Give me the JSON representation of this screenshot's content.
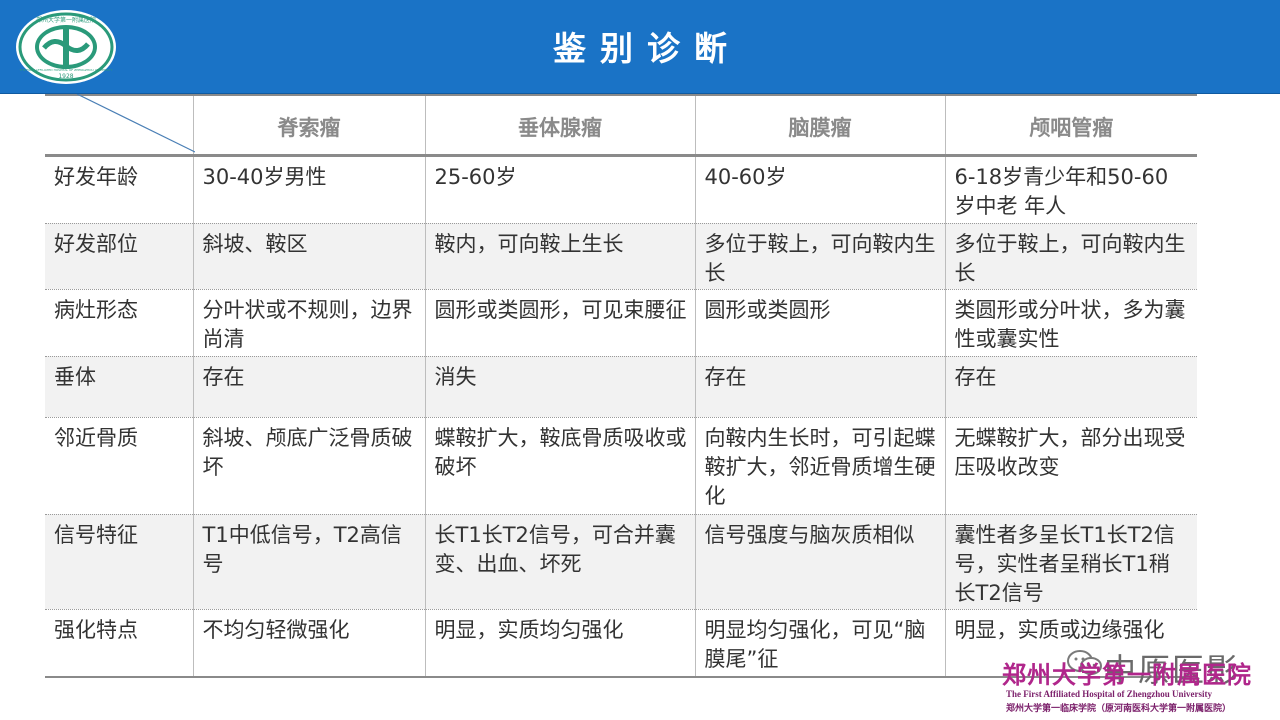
{
  "header": {
    "title": "鉴别诊断",
    "logo": {
      "ring_text": "郑州大学第一附属医院",
      "en_ring_text": "THE FIRST AFFILIATED HOSPITAL OF ZHENGZHOU UNIVERSITY",
      "year": "1928"
    }
  },
  "table": {
    "headers": [
      "",
      "脊索瘤",
      "垂体腺瘤",
      "脑膜瘤",
      "颅咽管瘤"
    ],
    "rows": [
      {
        "label": "好发年龄",
        "cells": [
          "30-40岁男性",
          "25-60岁",
          "40-60岁",
          "6-18岁青少年和50-60岁中老 年人"
        ]
      },
      {
        "label": "好发部位",
        "cells": [
          "斜坡、鞍区",
          "鞍内，可向鞍上生长",
          "多位于鞍上，可向鞍内生长",
          "多位于鞍上，可向鞍内生长"
        ]
      },
      {
        "label": "病灶形态",
        "cells": [
          "分叶状或不规则，边界尚清",
          "圆形或类圆形，可见束腰征",
          "圆形或类圆形",
          "类圆形或分叶状，多为囊性或囊实性"
        ]
      },
      {
        "label": "垂体",
        "cells": [
          "存在",
          "消失",
          "存在",
          "存在"
        ]
      },
      {
        "label": "邻近骨质",
        "cells": [
          "斜坡、颅底广泛骨质破坏",
          "蝶鞍扩大，鞍底骨质吸收或破坏",
          "向鞍内生长时，可引起蝶鞍扩大，邻近骨质增生硬化",
          "无蝶鞍扩大，部分出现受压吸收改变"
        ]
      },
      {
        "label": "信号特征",
        "cells": [
          "T1中低信号，T2高信号",
          "长T1长T2信号，可合并囊变、出血、坏死",
          "信号强度与脑灰质相似",
          "囊性者多呈长T1长T2信号，实性者呈稍长T1稍长T2信号"
        ]
      },
      {
        "label": "强化特点",
        "cells": [
          "不均匀轻微强化",
          "明显，实质均匀强化",
          "明显均匀强化，可见“脑膜尾”征",
          "明显，实质或边缘强化"
        ]
      }
    ]
  },
  "watermark": {
    "text": "中原医影",
    "icon": "wechat-icon"
  },
  "footer_logo": {
    "cn": "郑州大学第一附属医院",
    "en": "The First Affiliated Hospital of Zhengzhou University",
    "sub": "郑州大学第一临床学院（原河南医科大学第一附属医院）"
  },
  "colors": {
    "header_bg": "#1a73c6",
    "header_text": "#ffffff",
    "table_header_text": "#8a8a8a",
    "alt_row_bg": "#f2f2f2",
    "footer_logo": "#b0268b",
    "logo_green": "#2a9a7a"
  }
}
